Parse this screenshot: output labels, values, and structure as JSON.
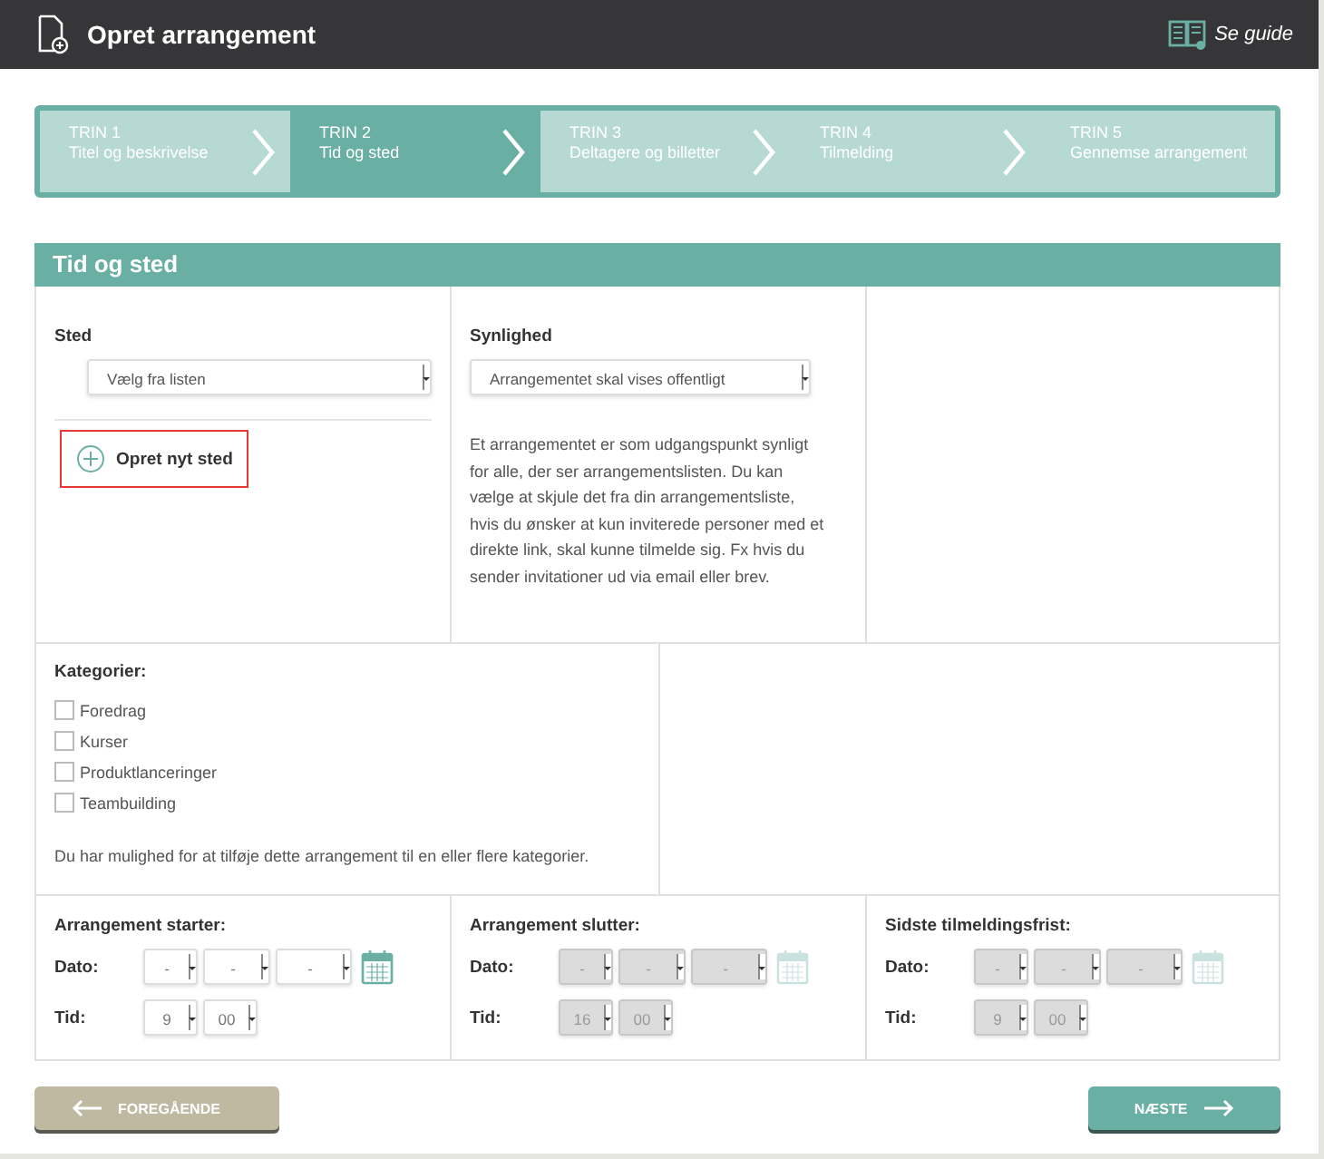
{
  "header": {
    "title": "Opret arrangement",
    "guide": "Se guide"
  },
  "steps": [
    {
      "number": "TRIN 1",
      "label": "Titel og beskrivelse",
      "selected": false
    },
    {
      "number": "TRIN 2",
      "label": "Tid og sted",
      "selected": true
    },
    {
      "number": "TRIN 3",
      "label": "Deltagere og billetter",
      "selected": false
    },
    {
      "number": "TRIN 4",
      "label": "Tilmelding",
      "selected": false
    },
    {
      "number": "TRIN 5",
      "label": "Gennemse arrangement",
      "selected": false
    }
  ],
  "section_title": "Tid og sted",
  "place": {
    "label": "Sted",
    "select": "Vælg fra listen",
    "create": "Opret nyt sted"
  },
  "visibility": {
    "label": "Synlighed",
    "select": "Arrangementet skal vises offentligt",
    "help": "Et arrangementet er som udgangspunkt synligt for alle, der ser arrangementslisten. Du kan vælge at skjule det fra din arrangementsliste, hvis du ønsker at kun inviterede personer med et direkte link, skal kunne tilmelde sig. Fx hvis du sender invitationer ud via email eller brev."
  },
  "categories": {
    "label": "Kategorier:",
    "items": [
      {
        "label": "Foredrag",
        "checked": false
      },
      {
        "label": "Kurser",
        "checked": false
      },
      {
        "label": "Produktlanceringer",
        "checked": false
      },
      {
        "label": "Teambuilding",
        "checked": false
      }
    ],
    "help": "Du har mulighed for at tilføje dette arrangement til en eller flere kategorier."
  },
  "times": [
    {
      "title": "Arrangement starter:",
      "date_label": "Dato:",
      "date": [
        "-",
        "-",
        "-"
      ],
      "time_label": "Tid:",
      "hour": "9",
      "minute": "00",
      "disabled": false
    },
    {
      "title": "Arrangement slutter:",
      "date_label": "Dato:",
      "date": [
        "-",
        "-",
        "-"
      ],
      "time_label": "Tid:",
      "hour": "16",
      "minute": "00",
      "disabled": true
    },
    {
      "title": "Sidste tilmeldingsfrist:",
      "date_label": "Dato:",
      "date": [
        "-",
        "-",
        "-"
      ],
      "time_label": "Tid:",
      "hour": "9",
      "minute": "00",
      "disabled": true
    }
  ],
  "buttons": {
    "previous": "FOREGÅENDE",
    "next": "NÆSTE"
  }
}
